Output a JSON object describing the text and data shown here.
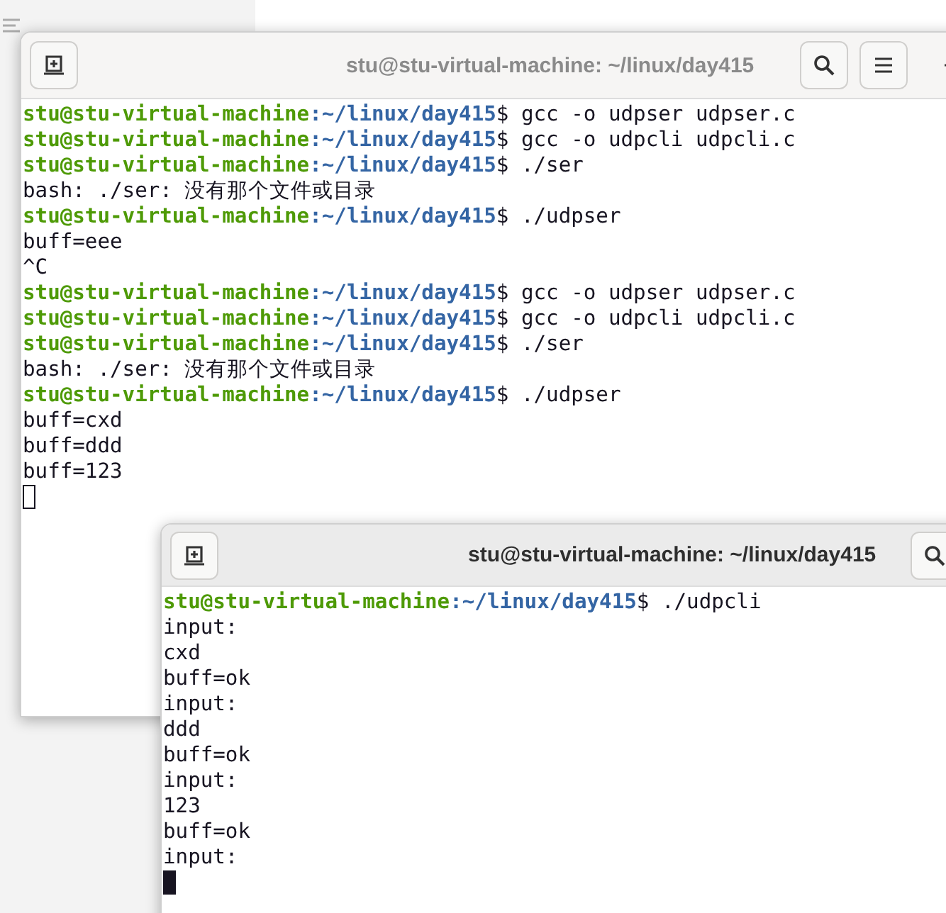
{
  "terminals": [
    {
      "title": "stu@stu-virtual-machine: ~/linux/day415",
      "lines": [
        {
          "kind": "prompt",
          "user": "stu@stu-virtual-machine",
          "path": ":~/linux/day415",
          "command": "$ gcc -o udpser udpser.c"
        },
        {
          "kind": "prompt",
          "user": "stu@stu-virtual-machine",
          "path": ":~/linux/day415",
          "command": "$ gcc -o udpcli udpcli.c"
        },
        {
          "kind": "prompt",
          "user": "stu@stu-virtual-machine",
          "path": ":~/linux/day415",
          "command": "$ ./ser"
        },
        {
          "kind": "output",
          "text": "bash: ./ser: 没有那个文件或目录"
        },
        {
          "kind": "prompt",
          "user": "stu@stu-virtual-machine",
          "path": ":~/linux/day415",
          "command": "$ ./udpser"
        },
        {
          "kind": "output",
          "text": "buff=eee"
        },
        {
          "kind": "output",
          "text": "^C"
        },
        {
          "kind": "prompt",
          "user": "stu@stu-virtual-machine",
          "path": ":~/linux/day415",
          "command": "$ gcc -o udpser udpser.c"
        },
        {
          "kind": "prompt",
          "user": "stu@stu-virtual-machine",
          "path": ":~/linux/day415",
          "command": "$ gcc -o udpcli udpcli.c"
        },
        {
          "kind": "prompt",
          "user": "stu@stu-virtual-machine",
          "path": ":~/linux/day415",
          "command": "$ ./ser"
        },
        {
          "kind": "output",
          "text": "bash: ./ser: 没有那个文件或目录"
        },
        {
          "kind": "prompt",
          "user": "stu@stu-virtual-machine",
          "path": ":~/linux/day415",
          "command": "$ ./udpser"
        },
        {
          "kind": "output",
          "text": "buff=cxd"
        },
        {
          "kind": "output",
          "text": "buff=ddd"
        },
        {
          "kind": "output",
          "text": "buff=123"
        },
        {
          "kind": "cursor",
          "focused": false
        }
      ]
    },
    {
      "title": "stu@stu-virtual-machine: ~/linux/day415",
      "lines": [
        {
          "kind": "prompt",
          "user": "stu@stu-virtual-machine",
          "path": ":~/linux/day415",
          "command": "$ ./udpcli"
        },
        {
          "kind": "output",
          "text": "input:"
        },
        {
          "kind": "output",
          "text": "cxd"
        },
        {
          "kind": "output",
          "text": "buff=ok"
        },
        {
          "kind": "output",
          "text": "input:"
        },
        {
          "kind": "output",
          "text": "ddd"
        },
        {
          "kind": "output",
          "text": "buff=ok"
        },
        {
          "kind": "output",
          "text": "input:"
        },
        {
          "kind": "output",
          "text": "123"
        },
        {
          "kind": "output",
          "text": "buff=ok"
        },
        {
          "kind": "output",
          "text": "input:"
        },
        {
          "kind": "cursor",
          "focused": true
        }
      ]
    }
  ]
}
